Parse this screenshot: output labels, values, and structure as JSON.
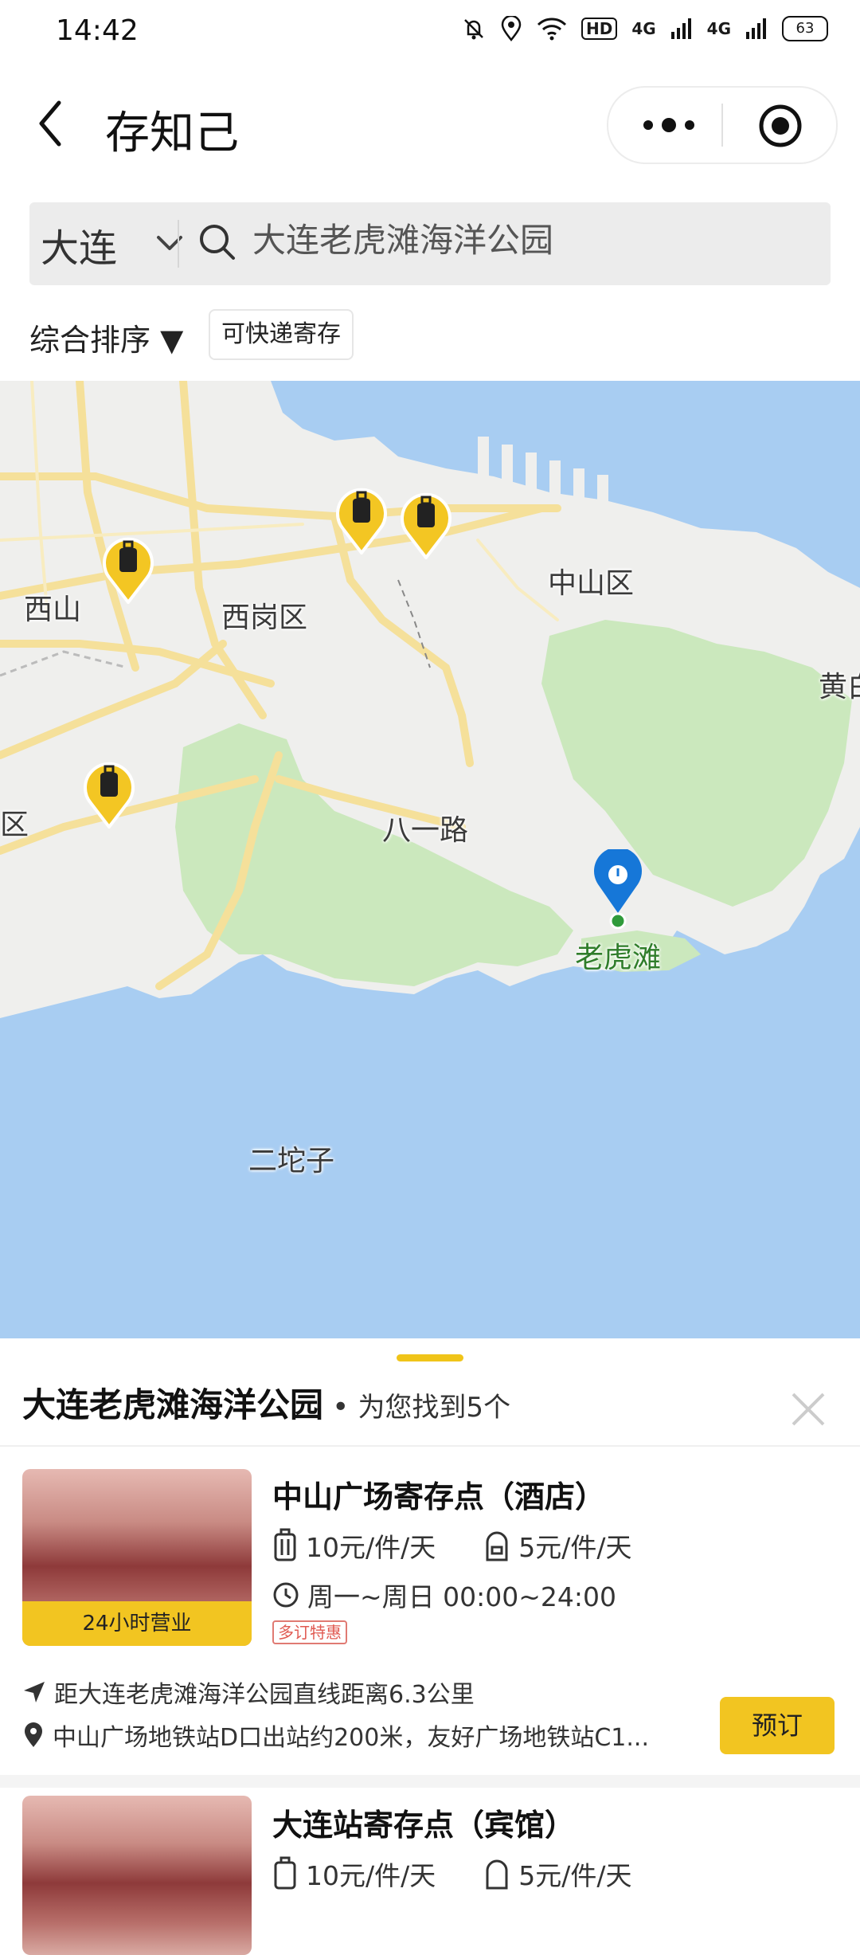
{
  "status_bar": {
    "time": "14:42",
    "hd": "HD",
    "net1": "4G",
    "net2": "4G",
    "battery": "63"
  },
  "header": {
    "back_icon": "chevron-left-icon",
    "title": "存知己",
    "more_icon": "more-dots-icon",
    "target_icon": "target-icon"
  },
  "search": {
    "city": "大连",
    "placeholder": "大连老虎滩海洋公园",
    "value": "大连老虎滩海洋公园"
  },
  "filters": {
    "sort_label": "综合排序 ▼",
    "chip_label": "可快递寄存"
  },
  "map": {
    "labels": [
      "西山",
      "西岗区",
      "中山区",
      "黄白",
      "区",
      "八一路",
      "老虎滩",
      "二坨子"
    ],
    "water_color": "#a8cdf2",
    "land_color": "#efefed",
    "green_color": "#cbe8bd",
    "road_color": "#f5e09a",
    "marker_color": "#f3c623",
    "pin_color": "#1677d8"
  },
  "sheet": {
    "location": "大连老虎滩海洋公园",
    "separator": "•",
    "found_text": "为您找到5个",
    "close_icon": "close-icon"
  },
  "stores": [
    {
      "name": "中山广场寄存点（酒店）",
      "price_large": "10元/件/天",
      "price_small": "5元/件/天",
      "hours": "周一~周日 00:00~24:00",
      "badge": "多订特惠",
      "thumb_label": "24小时营业",
      "distance": "距大连老虎滩海洋公园直线距离6.3公里",
      "address": "中山广场地铁站D口出站约200米，友好广场地铁站C1...",
      "book_label": "预订"
    },
    {
      "name": "大连站寄存点（宾馆）",
      "price_large": "10元/件/天",
      "price_small": "5元/件/天"
    }
  ]
}
